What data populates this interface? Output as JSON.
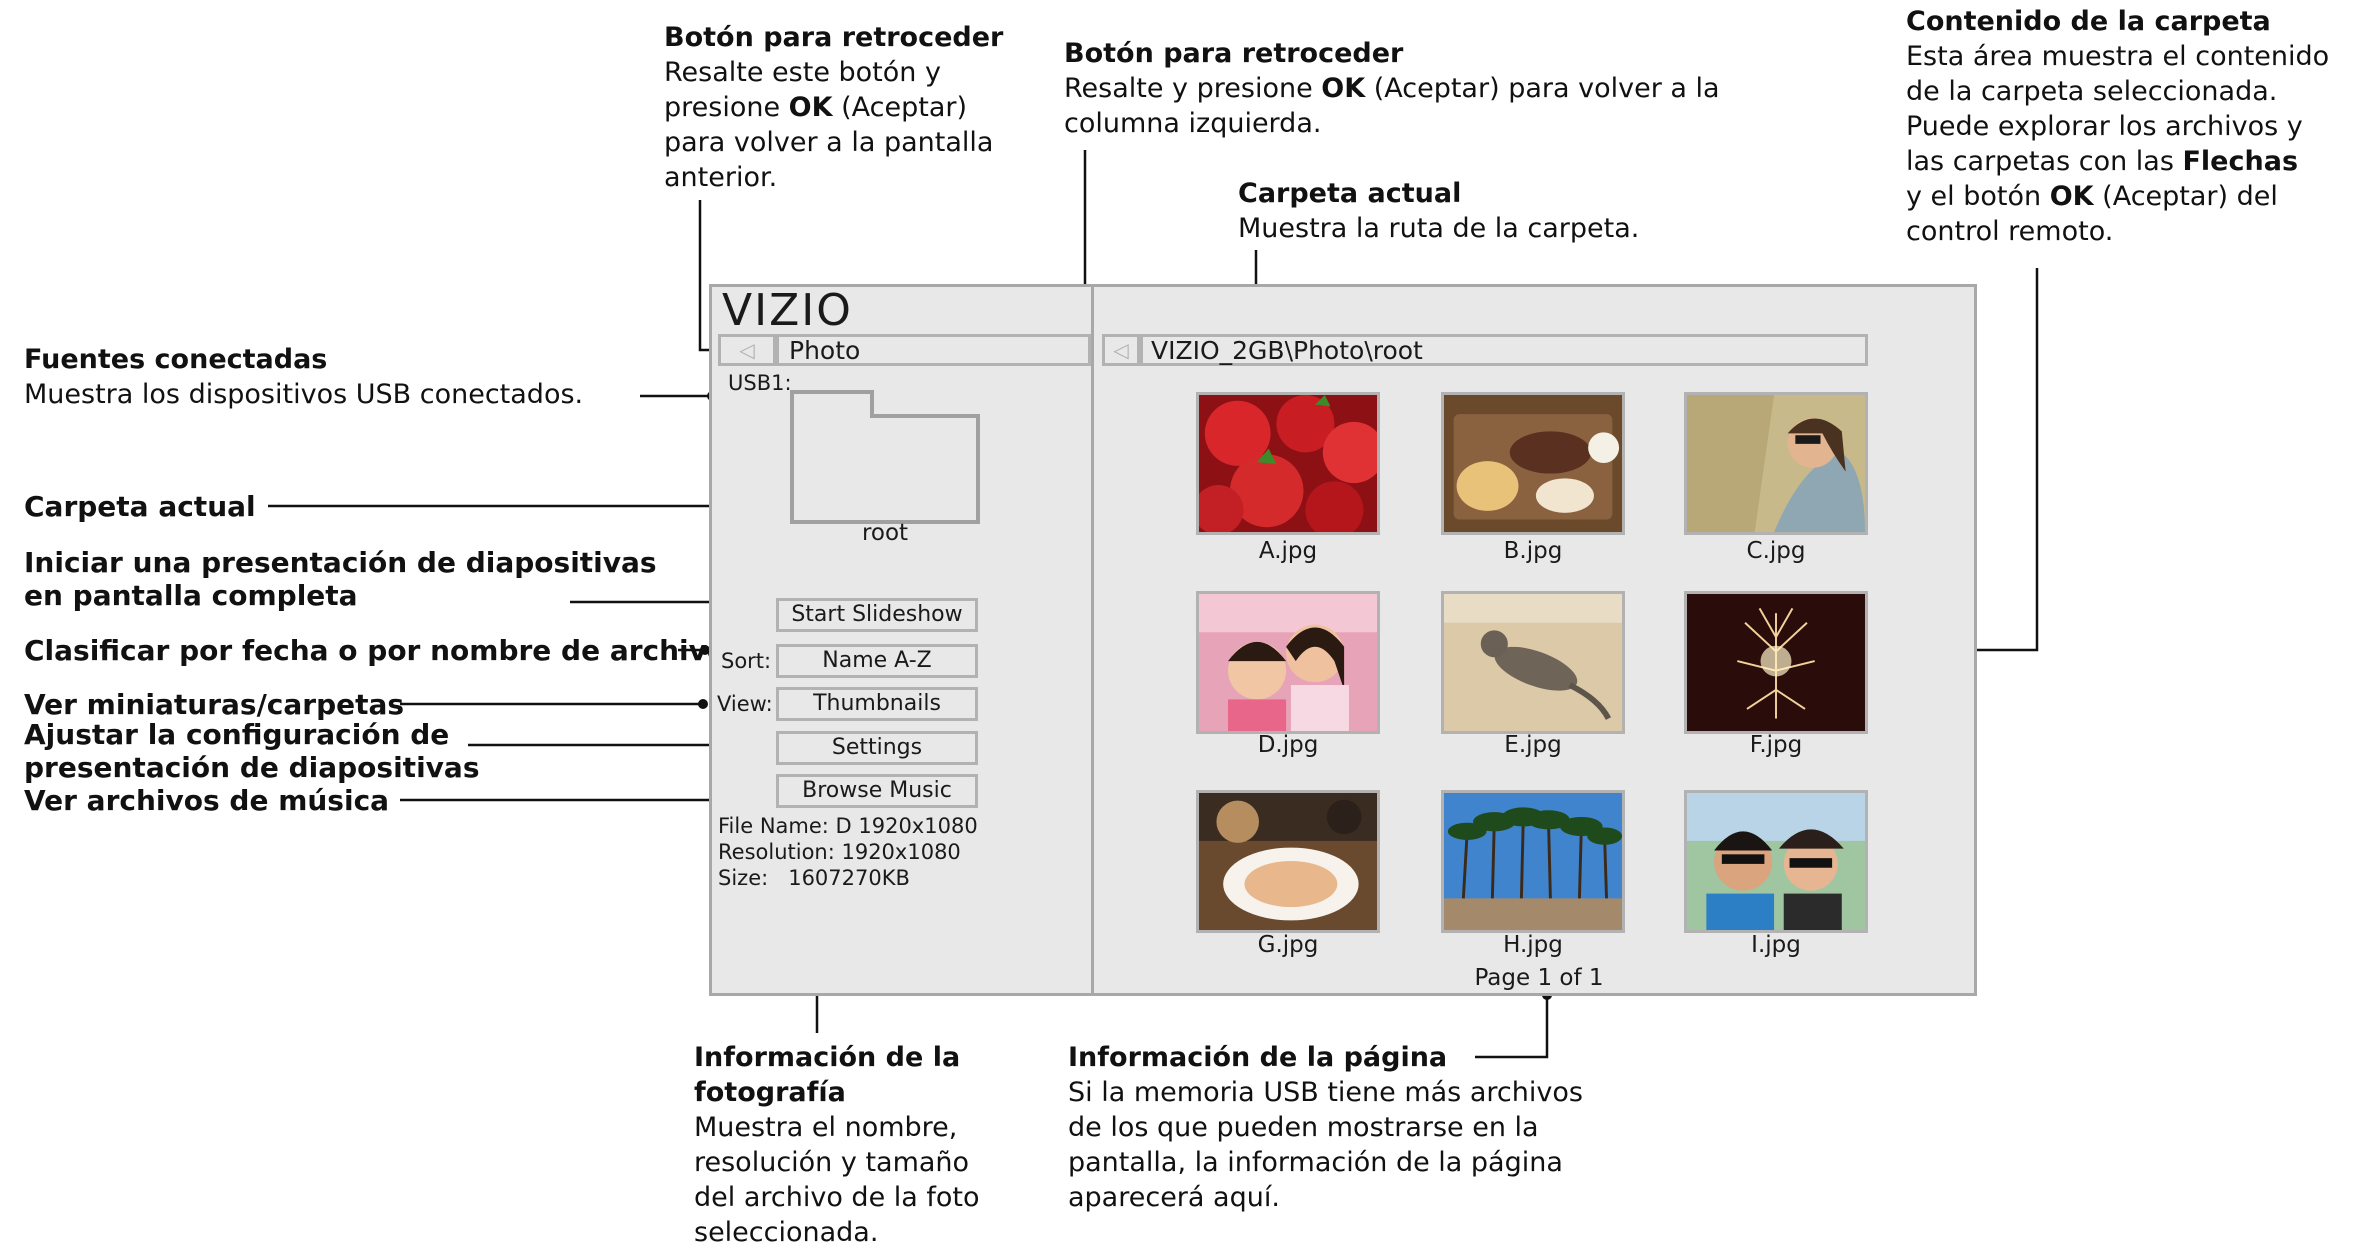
{
  "annotations": {
    "back_left": {
      "title": "Botón para retroceder",
      "line1": "Resalte este botón y",
      "line2_pre": "presione ",
      "line2_bold": "OK",
      "line2_post": " (Aceptar)",
      "line3": "para volver a la pantalla",
      "line4": "anterior."
    },
    "back_right": {
      "title": "Botón para retroceder",
      "line1_pre": "Resalte y presione ",
      "line1_bold": "OK",
      "line1_post": " (Aceptar) para volver a la",
      "line2": "columna izquierda."
    },
    "current_folder_top": {
      "title": "Carpeta actual",
      "desc": "Muestra la ruta de la carpeta."
    },
    "folder_contents": {
      "title": "Contenido de la carpeta",
      "line1": "Esta área muestra el contenido",
      "line2": "de la carpeta seleccionada.",
      "line3": "Puede explorar los archivos y",
      "line4_pre": "las carpetas con las ",
      "line4_bold": "Flechas",
      "line5_pre": "y el botón ",
      "line5_bold": "OK",
      "line5_post": " (Aceptar) del",
      "line6": "control remoto."
    },
    "connected_sources": {
      "title": "Fuentes conectadas",
      "desc": "Muestra los dispositivos USB conectados."
    },
    "current_folder_left": "Carpeta actual",
    "slideshow_line1": "Iniciar una presentación de diapositivas",
    "slideshow_line2": "en pantalla completa",
    "sort": "Clasificar por fecha o por nombre de archivo",
    "view": "Ver miniaturas/carpetas",
    "settings_line1": "Ajustar la configuración de",
    "settings_line2": "presentación de diapositivas",
    "music": "Ver archivos de música",
    "photo_info": {
      "title1": "Información de la",
      "title2": "fotografía",
      "line1": "Muestra el nombre,",
      "line2": "resolución y tamaño",
      "line3": "del archivo de la foto",
      "line4": "seleccionada."
    },
    "page_info": {
      "title": "Información de la página",
      "line1": "Si la memoria USB tiene más archivos",
      "line2": "de los que pueden mostrarse en la",
      "line3": "pantalla, la información de la página",
      "line4": "aparecerá aquí."
    }
  },
  "screen": {
    "logo": "VIZIO",
    "left_back_icon": "back-arrow-icon",
    "left_breadcrumb": "Photo",
    "right_back_icon": "back-arrow-icon",
    "path": "VIZIO_2GB\\Photo\\root",
    "source_label": "USB1:",
    "folder_name": "root",
    "buttons": {
      "start_slideshow": "Start Slideshow",
      "sort_label": "Sort:",
      "sort_value": "Name A-Z",
      "view_label": "View:",
      "view_value": "Thumbnails",
      "settings": "Settings",
      "browse_music": "Browse Music"
    },
    "file_info": {
      "name": "File Name: D 1920x1080",
      "resolution": "Resolution: 1920x1080",
      "size": "Size:   1607270KB"
    },
    "thumbnails": [
      {
        "caption": "A.jpg",
        "subject": "strawberries"
      },
      {
        "caption": "B.jpg",
        "subject": "meal tray"
      },
      {
        "caption": "C.jpg",
        "subject": "woman with sunglasses"
      },
      {
        "caption": "D.jpg",
        "subject": "two children"
      },
      {
        "caption": "E.jpg",
        "subject": "cat"
      },
      {
        "caption": "F.jpg",
        "subject": "fireworks"
      },
      {
        "caption": "G.jpg",
        "subject": "plate of food"
      },
      {
        "caption": "H.jpg",
        "subject": "palm trees"
      },
      {
        "caption": "I.jpg",
        "subject": "couple selfie"
      }
    ],
    "page_info": "Page 1 of 1"
  }
}
